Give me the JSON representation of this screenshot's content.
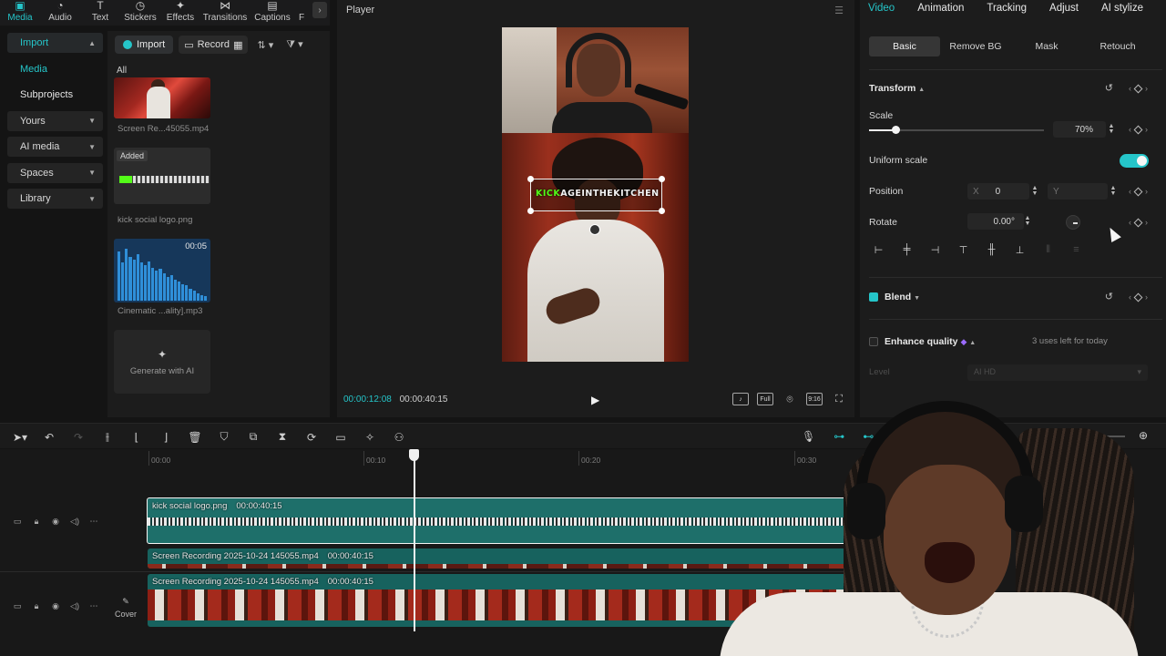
{
  "top_tabs": [
    {
      "label": "Media",
      "icon": "media-icon",
      "active": true
    },
    {
      "label": "Audio",
      "icon": "audio-icon"
    },
    {
      "label": "Text",
      "icon": "text-icon"
    },
    {
      "label": "Stickers",
      "icon": "stickers-icon"
    },
    {
      "label": "Effects",
      "icon": "effects-icon"
    },
    {
      "label": "Transitions",
      "icon": "transitions-icon"
    },
    {
      "label": "Captions",
      "icon": "captions-icon"
    },
    {
      "label": "F",
      "icon": "filters-icon"
    }
  ],
  "left_nav": {
    "import": "Import",
    "media": "Media",
    "subprojects": "Subprojects",
    "yours": "Yours",
    "ai_media": "AI media",
    "spaces": "Spaces",
    "library": "Library"
  },
  "media_panel": {
    "import_btn": "Import",
    "record_btn": "Record",
    "all_label": "All",
    "items": [
      {
        "name": "Screen Re...45055.mp4"
      },
      {
        "name": "kick social logo.png",
        "badge": "Added"
      },
      {
        "name": "Cinematic ...ality].mp3",
        "duration": "00:05"
      }
    ],
    "generate_ai": "Generate with AI"
  },
  "player": {
    "title": "Player",
    "overlay_text_green": "KICK",
    "overlay_text": "AGEINTHEKITCHEN",
    "current_time": "00:00:12:08",
    "total_time": "00:00:40:15",
    "full_label": "Full",
    "ratio_label": "9:16"
  },
  "inspector": {
    "tabs": [
      "Video",
      "Animation",
      "Tracking",
      "Adjust",
      "AI stylize"
    ],
    "active_tab": "Video",
    "sub_tabs": [
      "Basic",
      "Remove BG",
      "Mask",
      "Retouch"
    ],
    "transform_label": "Transform",
    "scale_label": "Scale",
    "scale_value": "70%",
    "scale_fraction": 0.15,
    "uniform_scale_label": "Uniform scale",
    "uniform_scale_on": true,
    "position_label": "Position",
    "position_x_axis": "X",
    "position_x": "0",
    "position_y_axis": "Y",
    "rotate_label": "Rotate",
    "rotate_value": "0.00°",
    "blend_label": "Blend",
    "enhance_label": "Enhance quality",
    "uses_left": "3 uses left for today",
    "level_label": "Level",
    "level_value": "AI HD"
  },
  "timeline": {
    "ruler": [
      "00:00",
      "00:10",
      "00:20",
      "00:30"
    ],
    "clips": [
      {
        "name": "kick social logo.png",
        "duration": "00:00:40:15"
      },
      {
        "name": "Screen Recording 2025-10-24 145055.mp4",
        "duration": "00:00:40:15"
      },
      {
        "name": "Screen Recording 2025-10-24 145055.mp4",
        "duration": "00:00:40:15"
      }
    ],
    "cover_label": "Cover"
  },
  "colors": {
    "accent": "#25c5c9",
    "kick_green": "#53fc18",
    "clip_teal": "#1e6f6a"
  }
}
